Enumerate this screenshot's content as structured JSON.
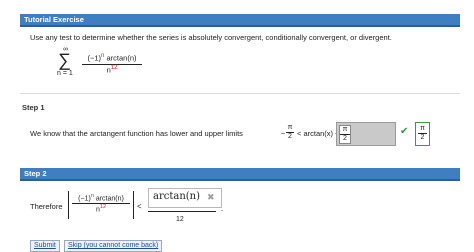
{
  "tutorial": {
    "title": "Tutorial Exercise",
    "instruction": "Use any test to determine whether the series is absolutely convergent, conditionally convergent, or divergent.",
    "series": {
      "sigma": "∑",
      "upper": "∞",
      "lower": "n = 1",
      "numerator_base": "(−1)",
      "numerator_exp": "n",
      "numerator_rest": " arctan(n)",
      "denominator_base": "n",
      "denominator_exp": "12"
    }
  },
  "step1": {
    "label": "Step 1",
    "text": "We know that the arctangent function has lower and upper limits",
    "lower_prefix": "−",
    "lower_num": "π",
    "lower_den": "2",
    "middle": "< arctan(x) <",
    "input_num": "π",
    "input_den": "2",
    "answer_num": "π",
    "answer_den": "2",
    "check_symbol": "✔"
  },
  "step2": {
    "title": "Step 2",
    "therefore": "Therefore",
    "abs_num_base": "(−1)",
    "abs_num_exp": "n",
    "abs_num_rest": " arctan(n)",
    "abs_den_base": "n",
    "abs_den_exp": "12",
    "less_than": "<",
    "input_value": "arctan(n)",
    "wrong_symbol": "✖",
    "rhs_den": "12",
    "period": "."
  },
  "buttons": {
    "submit": "Submit",
    "skip": "Skip (you cannot come back)"
  },
  "colors": {
    "header_bar": "#3f7ec0",
    "correct": "#2f9a2f",
    "incorrect": "#a0a0a0",
    "exponent_red": "#d21c1c"
  }
}
